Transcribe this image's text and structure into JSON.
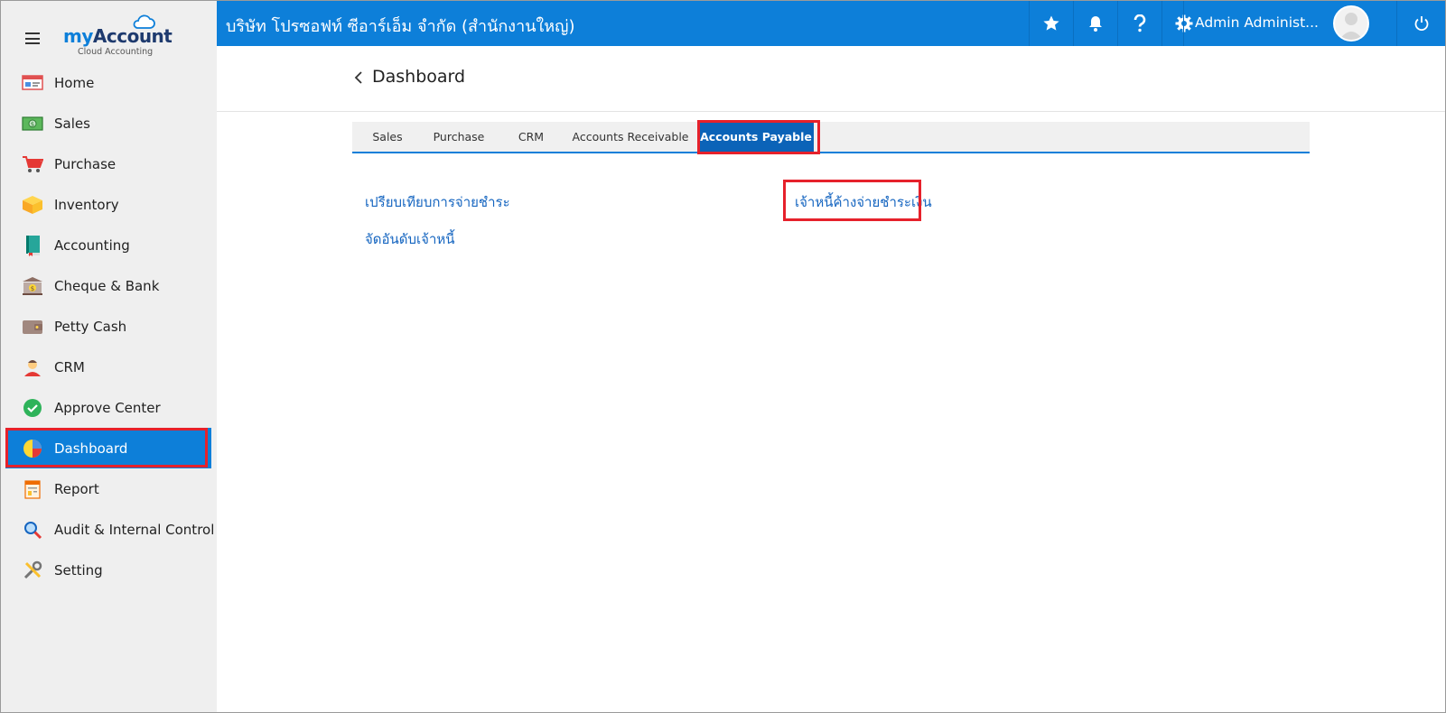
{
  "app": {
    "logo_my": "my",
    "logo_account": "Account",
    "logo_sub": "Cloud Accounting"
  },
  "sidebar": {
    "items": [
      {
        "label": "Home",
        "icon": "home-icon"
      },
      {
        "label": "Sales",
        "icon": "sales-money-icon"
      },
      {
        "label": "Purchase",
        "icon": "cart-icon"
      },
      {
        "label": "Inventory",
        "icon": "box-icon"
      },
      {
        "label": "Accounting",
        "icon": "ledger-book-icon"
      },
      {
        "label": "Cheque & Bank",
        "icon": "bank-icon"
      },
      {
        "label": "Petty Cash",
        "icon": "wallet-icon"
      },
      {
        "label": "CRM",
        "icon": "person-icon"
      },
      {
        "label": "Approve Center",
        "icon": "check-circle-icon"
      },
      {
        "label": "Dashboard",
        "icon": "pie-chart-icon"
      },
      {
        "label": "Report",
        "icon": "report-icon"
      },
      {
        "label": "Audit & Internal Control",
        "icon": "magnifier-icon"
      },
      {
        "label": "Setting",
        "icon": "tools-icon"
      }
    ],
    "active_index": 9
  },
  "topbar": {
    "company": "บริษัท โปรซอฟท์ ซีอาร์เอ็ม จำกัด (สำนักงานใหญ่)",
    "user_name": "Admin Administ..."
  },
  "main": {
    "title": "Dashboard",
    "tabs": [
      "Sales",
      "Purchase",
      "CRM",
      "Accounts Receivable",
      "Accounts Payable"
    ],
    "active_tab": "Accounts Payable",
    "links": {
      "compare_payment": "เปรียบเทียบการจ่ายชำระ",
      "rank_creditors": "จัดอันดับเจ้าหนี้",
      "outstanding_payables": "เจ้าหนี้ค้างจ่ายชำระเงิน"
    }
  },
  "colors": {
    "brand_blue": "#0d7fd9",
    "active_tab": "#0b63b8",
    "highlight_red": "#e6212b",
    "link_blue": "#1565c0"
  }
}
